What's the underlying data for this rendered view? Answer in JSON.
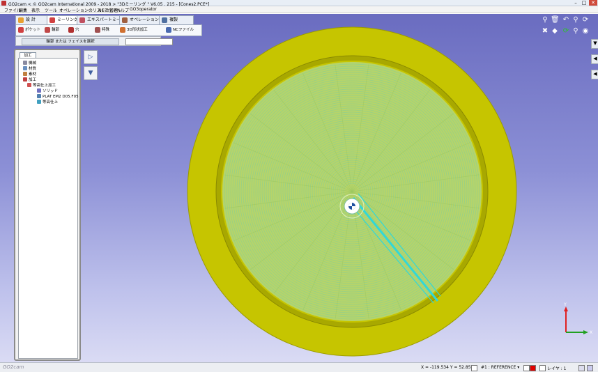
{
  "window": {
    "title": "GO2cam < © GO2cam International 2009 - 2018 >    \"3Dミーリング \"   V6.05 . 215 - [Cones2.PCE*]",
    "minimize": "–",
    "maximize": "□",
    "close": "✕"
  },
  "menu": [
    "ファイル",
    "編集",
    "表示",
    "ツール",
    "オペレーションのリストの管理",
    "NCファイル",
    "ヘルプ",
    "GO3operator"
  ],
  "ribbon": {
    "tabs": [
      "設 計",
      "ミーリング",
      "エキスパートミーリング",
      "オペレーションリスト",
      "複製"
    ],
    "row": [
      "ポケット",
      "輪郭",
      "穴",
      "特殊",
      "3D形状加工",
      "NCファイル"
    ]
  },
  "selection": {
    "label": "輪郭 または フェイスを選択",
    "value": ""
  },
  "panel": {
    "tab": "加工",
    "tree": [
      "機械",
      "材質",
      "素材",
      "加工",
      "等高仕上加工",
      "ソリッド",
      "PLAT EM2 D05.F05",
      "等高仕上"
    ]
  },
  "viewport": {
    "axes": {
      "x": "X",
      "y": "Y"
    }
  },
  "statusbar": {
    "brand": "GO2cam",
    "coords": "X = -119.534 Y = 52.850",
    "layer": "#1 : REFERENCE",
    "layer_dropdown": "▾",
    "layer_count": "レイヤ : 1"
  },
  "colors": {
    "part": "#c4c400",
    "part_dark": "#8f8f00",
    "toolpath": "#8fcf8f",
    "toolpath_link": "#30d8d8",
    "accent": "#2a6bd0"
  },
  "icons": {
    "tools": [
      "view-icon",
      "trash-icon",
      "undo-icon",
      "zoom-icon",
      "rotate-icon",
      "hide-icon",
      "erase-icon",
      "refresh-icon",
      "zoom-window-icon",
      "eye-icon"
    ]
  }
}
